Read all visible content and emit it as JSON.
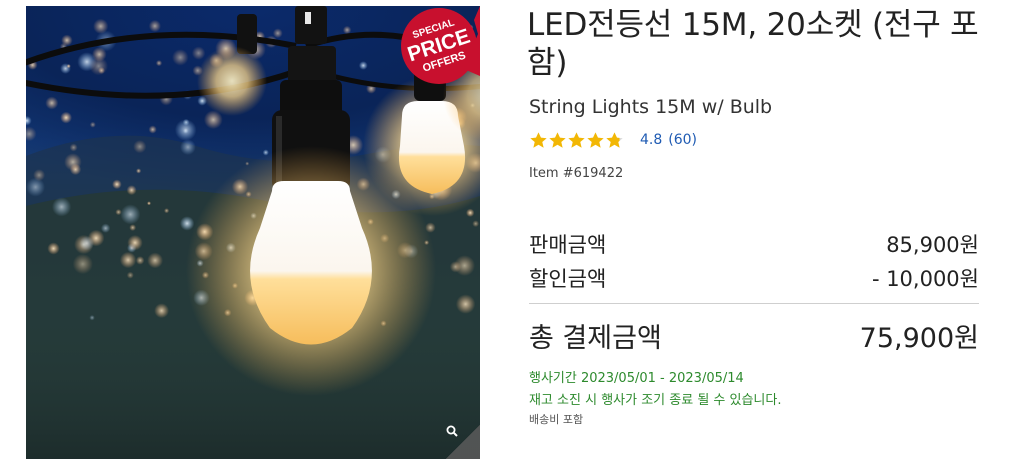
{
  "product": {
    "title": "LED전등선 15M, 20소켓 (전구 포함)",
    "subtitle": "String Lights 15M w/ Bulb",
    "rating": {
      "value": "4.8",
      "count": "(60)",
      "stars_filled": 4.8,
      "stars_total": 5,
      "star_color": "#f2b705"
    },
    "item_number": "Item #619422"
  },
  "badge": {
    "line1": "SPECIAL",
    "line2": "PRICE",
    "line3": "OFFERS",
    "color": "#c8102e"
  },
  "pricing": {
    "sale_label": "판매금액",
    "sale_value": "85,900원",
    "discount_label": "할인금액",
    "discount_value": "- 10,000원",
    "total_label": "총 결제금액",
    "total_value": "75,900원"
  },
  "promotion": {
    "period": "행사기간 2023/05/01 - 2023/05/14",
    "note": "재고 소진 시 행사가 조기 종료 될 수 있습니다.",
    "color": "#2d8a2d"
  },
  "shipping": {
    "text": "배송비 포함"
  },
  "image": {
    "alt": "product-photo-string-lights",
    "zoom_icon": "zoom-icon"
  }
}
